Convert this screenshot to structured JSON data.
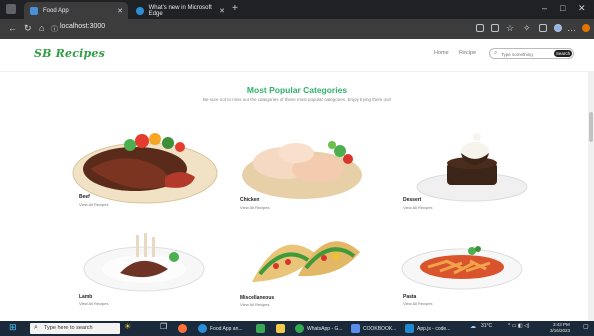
{
  "browser": {
    "tabs": [
      {
        "label": "Food App",
        "active": true
      },
      {
        "label": "What's new in Microsoft Edge",
        "active": false
      }
    ],
    "url": "localhost:3000",
    "search_placeholder": "Type something"
  },
  "page": {
    "logo": "SB Recipes",
    "nav": [
      "Home",
      "Recipe"
    ],
    "search_button": "Search",
    "title": "Most Popular Categories",
    "subtitle": "Be sure not to miss out the categories of these most popular categories. Enjoy trying them out!",
    "categories": [
      {
        "name": "Beef",
        "link": "View All Recipes"
      },
      {
        "name": "Chicken",
        "link": "View All Recipes"
      },
      {
        "name": "Dessert",
        "link": "View All Recipes"
      },
      {
        "name": "Lamb",
        "link": "View All Recipes"
      },
      {
        "name": "Miscellaneous",
        "link": "View All Recipes"
      },
      {
        "name": "Pasta",
        "link": "View All Recipes"
      }
    ]
  },
  "taskbar": {
    "search_text": "Type here to search",
    "apps": [
      {
        "label": "Food App an..."
      },
      {
        "label": "WhatsApp - G..."
      },
      {
        "label": "COOKBOOK..."
      },
      {
        "label": "App.js - code..."
      }
    ],
    "weather": "31°C",
    "time": "3:43 PM",
    "date": "3/16/2023"
  },
  "colors": {
    "accent": "#2fb36b",
    "logo": "#2f9e44",
    "taskbar": "#1b2a3a",
    "chrome": "#202124"
  }
}
